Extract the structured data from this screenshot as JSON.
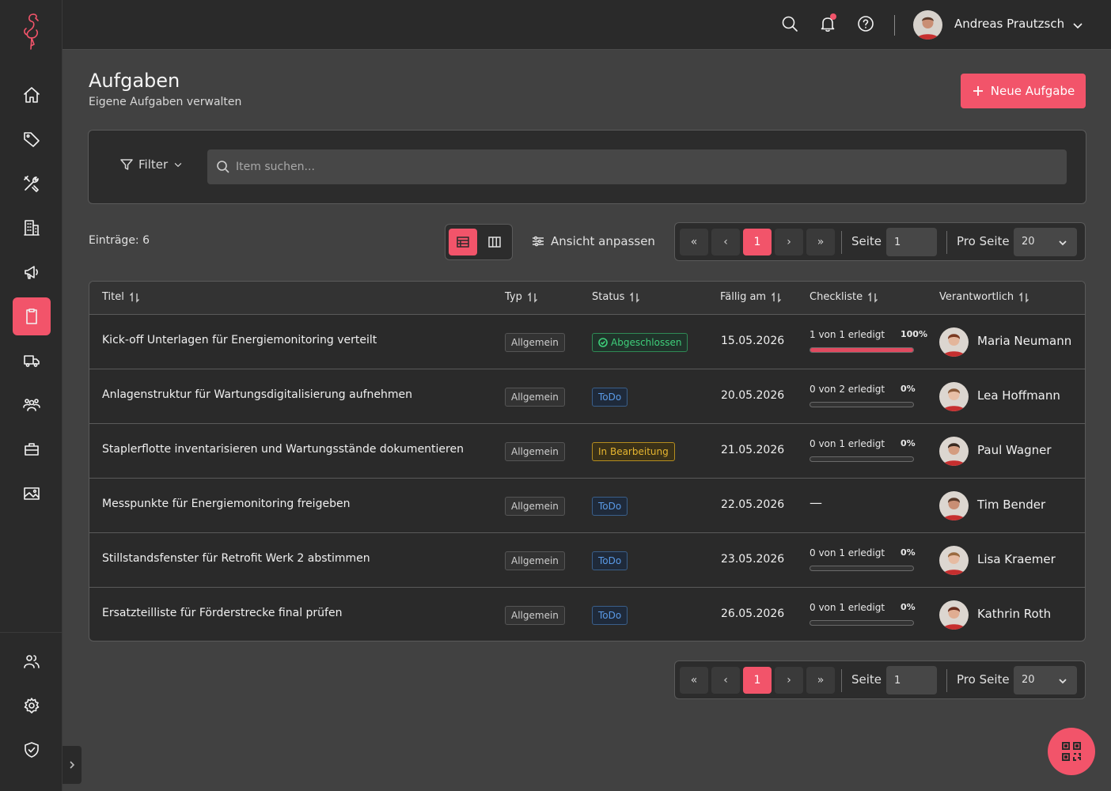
{
  "user": {
    "name": "Andreas Prautzsch"
  },
  "page": {
    "title": "Aufgaben",
    "subtitle": "Eigene Aufgaben verwalten",
    "new_button": "Neue Aufgabe"
  },
  "filter": {
    "label": "Filter",
    "search_placeholder": "Item suchen..."
  },
  "toolbar": {
    "entries": "Einträge: 6",
    "adjust_view": "Ansicht anpassen"
  },
  "pagination": {
    "first": "«",
    "prev": "‹",
    "current": "1",
    "next": "›",
    "last": "»",
    "page_label": "Seite",
    "page_value": "1",
    "per_page_label": "Pro Seite",
    "per_page_value": "20"
  },
  "table": {
    "headers": [
      "Titel",
      "Typ",
      "Status",
      "Fällig am",
      "Checkliste",
      "Verantwortlich"
    ],
    "rows": [
      {
        "title": "Kick-off Unterlagen für Energiemonitoring verteilt",
        "type": "Allgemein",
        "status": "Abgeschlossen",
        "due": "15.05.2026",
        "checklist": "1 von 1 erledigt",
        "pct": "100%",
        "progress": 1.0,
        "person": "Maria Neumann"
      },
      {
        "title": "Anlagenstruktur für Wartungsdigitalisierung aufnehmen",
        "type": "Allgemein",
        "status": "ToDo",
        "due": "20.05.2026",
        "checklist": "0 von 2 erledigt",
        "pct": "0%",
        "progress": 0,
        "person": "Lea Hoffmann"
      },
      {
        "title": "Staplerflotte inventarisieren und Wartungsstände dokumentieren",
        "type": "Allgemein",
        "status": "In Bearbeitung",
        "due": "21.05.2026",
        "checklist": "0 von 1 erledigt",
        "pct": "0%",
        "progress": 0,
        "person": "Paul Wagner"
      },
      {
        "title": "Messpunkte für Energiemonitoring freigeben",
        "type": "Allgemein",
        "status": "ToDo",
        "due": "22.05.2026",
        "checklist": "—",
        "pct": "",
        "progress": null,
        "person": "Tim Bender"
      },
      {
        "title": "Stillstandsfenster für Retrofit Werk 2 abstimmen",
        "type": "Allgemein",
        "status": "ToDo",
        "due": "23.05.2026",
        "checklist": "0 von 1 erledigt",
        "pct": "0%",
        "progress": 0,
        "person": "Lisa Kraemer"
      },
      {
        "title": "Ersatzteilliste für Förderstrecke final prüfen",
        "type": "Allgemein",
        "status": "ToDo",
        "due": "26.05.2026",
        "checklist": "0 von 1 erledigt",
        "pct": "0%",
        "progress": 0,
        "person": "Kathrin Roth"
      }
    ]
  },
  "colors": {
    "accent": "#f2546a",
    "done": "#3ecf7a",
    "todo": "#5a9ae6",
    "in_progress": "#e6b530"
  }
}
